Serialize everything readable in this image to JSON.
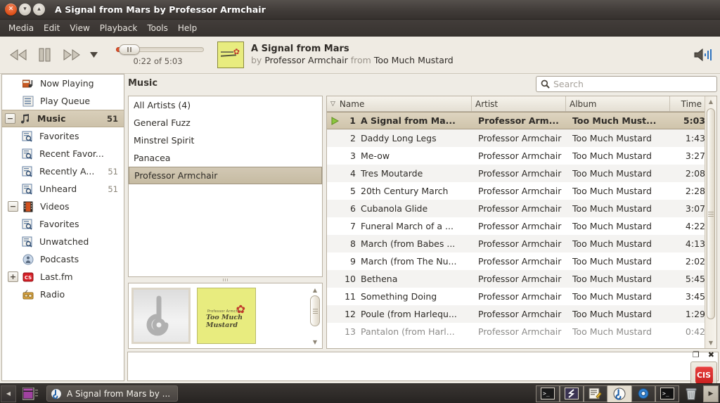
{
  "window": {
    "title": "A Signal from Mars by Professor Armchair",
    "close_glyph": "✕",
    "minimize_glyph": "▾",
    "maximize_glyph": "▴"
  },
  "menubar": {
    "items": [
      "Media",
      "Edit",
      "View",
      "Playback",
      "Tools",
      "Help"
    ]
  },
  "toolbar": {
    "previous_label": "Previous",
    "playpause_label": "Pause",
    "next_label": "Next",
    "dropdown_glyph": "▼",
    "seek_time": "0:22 of 5:03",
    "seek_position": "0:22",
    "seek_duration": "5:03",
    "volume_label": "Volume"
  },
  "now_playing": {
    "title": "A Signal from Mars",
    "by_word": "by",
    "artist": "Professor Armchair",
    "from_word": "from",
    "album": "Too Much Mustard",
    "cover_line1": "Professor Armchair",
    "cover_line2": "Too Much Mustard"
  },
  "sidebar": {
    "items": [
      {
        "label": "Now Playing",
        "icon": "now-playing-icon",
        "count": "",
        "indent": 1,
        "expander": "",
        "selected": false
      },
      {
        "label": "Play Queue",
        "icon": "play-queue-icon",
        "count": "",
        "indent": 1,
        "expander": "",
        "selected": false
      },
      {
        "label": "Music",
        "icon": "music-note-icon",
        "count": "51",
        "indent": 0,
        "expander": "−",
        "selected": true
      },
      {
        "label": "Favorites",
        "icon": "smart-playlist-icon",
        "count": "",
        "indent": 2,
        "expander": "",
        "selected": false
      },
      {
        "label": "Recent Favor...",
        "icon": "smart-playlist-icon",
        "count": "",
        "indent": 2,
        "expander": "",
        "selected": false
      },
      {
        "label": "Recently A...",
        "icon": "smart-playlist-icon",
        "count": "51",
        "indent": 2,
        "expander": "",
        "selected": false
      },
      {
        "label": "Unheard",
        "icon": "smart-playlist-icon",
        "count": "51",
        "indent": 2,
        "expander": "",
        "selected": false
      },
      {
        "label": "Videos",
        "icon": "video-icon",
        "count": "",
        "indent": 0,
        "expander": "−",
        "selected": false
      },
      {
        "label": "Favorites",
        "icon": "smart-playlist-icon",
        "count": "",
        "indent": 2,
        "expander": "",
        "selected": false
      },
      {
        "label": "Unwatched",
        "icon": "smart-playlist-icon",
        "count": "",
        "indent": 2,
        "expander": "",
        "selected": false
      },
      {
        "label": "Podcasts",
        "icon": "podcast-icon",
        "count": "",
        "indent": 1,
        "expander": "",
        "selected": false
      },
      {
        "label": "Last.fm",
        "icon": "lastfm-icon",
        "count": "",
        "indent": 0,
        "expander": "+",
        "selected": false
      },
      {
        "label": "Radio",
        "icon": "radio-icon",
        "count": "",
        "indent": 1,
        "expander": "",
        "selected": false
      }
    ]
  },
  "content": {
    "source_label": "Music",
    "search": {
      "placeholder": "Search",
      "value": ""
    }
  },
  "artist_browser": {
    "items": [
      {
        "label": "All Artists (4)",
        "selected": false
      },
      {
        "label": "General Fuzz",
        "selected": false
      },
      {
        "label": "Minstrel Spirit",
        "selected": false
      },
      {
        "label": "Panacea",
        "selected": false
      },
      {
        "label": "Professor Armchair",
        "selected": true
      }
    ]
  },
  "album_browser": {
    "covers": [
      {
        "name": "generic-album-cover",
        "selected": true
      },
      {
        "name": "too-much-mustard-cover",
        "selected": false,
        "line1": "Professor Armchair",
        "line2": "Too Much Mustard"
      }
    ]
  },
  "tracklist": {
    "columns": [
      {
        "key": "name",
        "label": "Name",
        "sorted": true,
        "sort_glyph": "▽"
      },
      {
        "key": "artist",
        "label": "Artist",
        "sorted": false,
        "sort_glyph": ""
      },
      {
        "key": "album",
        "label": "Album",
        "sorted": false,
        "sort_glyph": ""
      },
      {
        "key": "time",
        "label": "Time",
        "sorted": false,
        "sort_glyph": ""
      }
    ],
    "rows": [
      {
        "num": "1",
        "name": "A Signal from Ma...",
        "artist": "Professor Arm...",
        "album": "Too Much Must...",
        "time": "5:03",
        "playing": true
      },
      {
        "num": "2",
        "name": "Daddy Long Legs",
        "artist": "Professor Armchair",
        "album": "Too Much Mustard",
        "time": "1:43",
        "playing": false
      },
      {
        "num": "3",
        "name": "Me-ow",
        "artist": "Professor Armchair",
        "album": "Too Much Mustard",
        "time": "3:27",
        "playing": false
      },
      {
        "num": "4",
        "name": "Tres Moutarde",
        "artist": "Professor Armchair",
        "album": "Too Much Mustard",
        "time": "2:08",
        "playing": false
      },
      {
        "num": "5",
        "name": "20th Century March",
        "artist": "Professor Armchair",
        "album": "Too Much Mustard",
        "time": "2:28",
        "playing": false
      },
      {
        "num": "6",
        "name": "Cubanola Glide",
        "artist": "Professor Armchair",
        "album": "Too Much Mustard",
        "time": "3:07",
        "playing": false
      },
      {
        "num": "7",
        "name": "Funeral March of a ...",
        "artist": "Professor Armchair",
        "album": "Too Much Mustard",
        "time": "4:22",
        "playing": false
      },
      {
        "num": "8",
        "name": "March (from Babes ...",
        "artist": "Professor Armchair",
        "album": "Too Much Mustard",
        "time": "4:13",
        "playing": false
      },
      {
        "num": "9",
        "name": "March (from The Nu...",
        "artist": "Professor Armchair",
        "album": "Too Much Mustard",
        "time": "2:02",
        "playing": false
      },
      {
        "num": "10",
        "name": "Bethena",
        "artist": "Professor Armchair",
        "album": "Too Much Mustard",
        "time": "5:45",
        "playing": false
      },
      {
        "num": "11",
        "name": "Something Doing",
        "artist": "Professor Armchair",
        "album": "Too Much Mustard",
        "time": "3:45",
        "playing": false
      },
      {
        "num": "12",
        "name": "Poule (from Harlequ...",
        "artist": "Professor Armchair",
        "album": "Too Much Mustard",
        "time": "1:29",
        "playing": false
      },
      {
        "num": "13",
        "name": "Pantalon (from Harl...",
        "artist": "Professor Armchair",
        "album": "Too Much Mustard",
        "time": "0:42",
        "playing": false
      }
    ]
  },
  "desktop": {
    "restore_glyph": "❐",
    "close_glyph": "✖",
    "lastfm_badge": "CIS"
  },
  "taskbar": {
    "arrow_glyph": "◀",
    "window_button_label": "A Signal from Mars by ...",
    "tray_items": [
      {
        "name": "terminal-icon",
        "framed": true,
        "active": false
      },
      {
        "name": "scribus-icon",
        "framed": true,
        "active": false
      },
      {
        "name": "text-editor-icon",
        "framed": true,
        "active": false
      },
      {
        "name": "banshee-icon",
        "framed": false,
        "active": true
      },
      {
        "name": "chromium-icon",
        "framed": true,
        "active": false
      },
      {
        "name": "terminal2-icon",
        "framed": true,
        "active": false
      },
      {
        "name": "trash-icon",
        "framed": false,
        "active": false
      }
    ],
    "play_glyph": "▶"
  },
  "colors": {
    "accent": "#d9cfba",
    "selection": "#cdc2aa",
    "seek_fill": "#e2502a",
    "play_marker": "#7fa93a",
    "cover_yellow": "#e8ec7f"
  }
}
